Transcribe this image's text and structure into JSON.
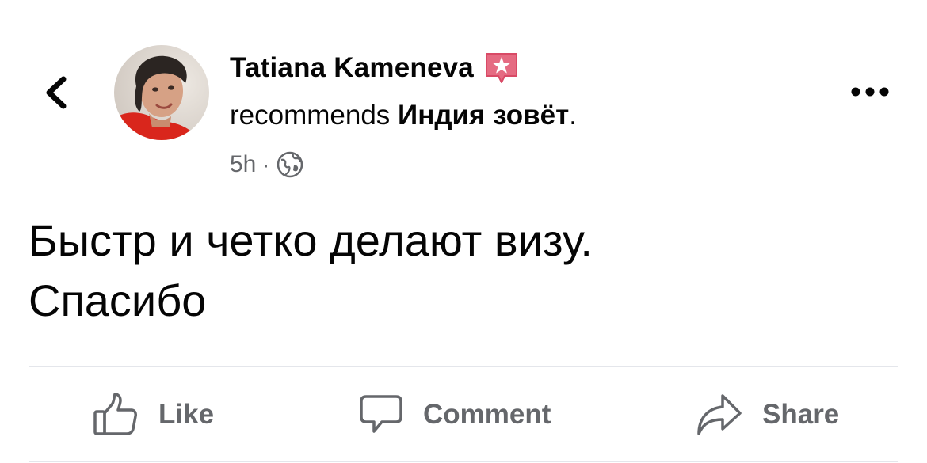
{
  "post": {
    "author": "Tatiana Kameneva",
    "recommends_prefix": "recommends ",
    "page_name": "Индия зовёт",
    "recommends_suffix": ".",
    "timestamp": "5h",
    "separator": "·",
    "text_line1": "Быстр и четко делают визу.",
    "text_line2": "Спасибо"
  },
  "actions": {
    "like": "Like",
    "comment": "Comment",
    "share": "Share"
  },
  "icons": {
    "back": "chevron-left-icon",
    "recommend": "recommend-star-icon",
    "audience": "globe-icon",
    "more": "more-horizontal-icon",
    "like": "thumbs-up-icon",
    "comment": "speech-bubble-icon",
    "share": "share-arrow-icon"
  },
  "colors": {
    "text_primary": "#050505",
    "text_secondary": "#65676b",
    "recommend_badge": "#e56b82",
    "divider": "#e4e6eb"
  }
}
